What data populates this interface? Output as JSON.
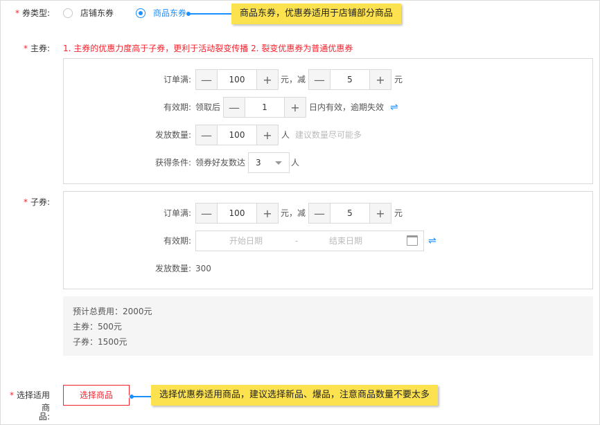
{
  "coupon_type": {
    "label": "券类型:",
    "options": [
      {
        "label": "店铺东券",
        "selected": false
      },
      {
        "label": "商品东券",
        "selected": true
      }
    ],
    "callout": "商品东券，优惠券适用于店铺部分商品"
  },
  "main_coupon": {
    "label": "主券:",
    "hint": "1. 主券的优惠力度高于子券，更利于活动裂变传播 2. 裂变优惠券为普通优惠券",
    "order_label": "订单满:",
    "order_min": "100",
    "yuan_comma_minus": "元，减",
    "discount": "5",
    "yuan": "元",
    "validity_label": "有效期:",
    "validity_prefix": "领取后",
    "validity_days": "1",
    "validity_suffix": "日内有效，逾期失效",
    "swap_icon": "⇌",
    "quantity_label": "发放数量:",
    "quantity": "100",
    "quantity_unit": "人",
    "quantity_hint": "建议数量尽可能多",
    "condition_label": "获得条件:",
    "condition_prefix": "领券好友数达",
    "condition_value": "3",
    "condition_unit": "人"
  },
  "sub_coupon": {
    "label": "子券:",
    "order_label": "订单满:",
    "order_min": "100",
    "yuan_comma_minus": "元，减",
    "discount": "5",
    "yuan": "元",
    "validity_label": "有效期:",
    "start_placeholder": "开始日期",
    "dash": "-",
    "end_placeholder": "结束日期",
    "swap_icon": "⇌",
    "quantity_label": "发放数量:",
    "quantity_value": "300"
  },
  "summary": {
    "total": "预计总费用：2000元",
    "main": "主券：500元",
    "sub": "子券：1500元"
  },
  "goods": {
    "label_line1": "选择适用商",
    "label_line2": "品:",
    "button": "选择商品",
    "callout": "选择优惠券适用商品，建议选择新品、爆品，注意商品数量不要太多"
  },
  "stepper": {
    "minus": "—",
    "plus": "+"
  },
  "required_mark": "*",
  "colors": {
    "accent": "#1890ff",
    "required": "#f5222d",
    "callout": "#fde24f"
  }
}
